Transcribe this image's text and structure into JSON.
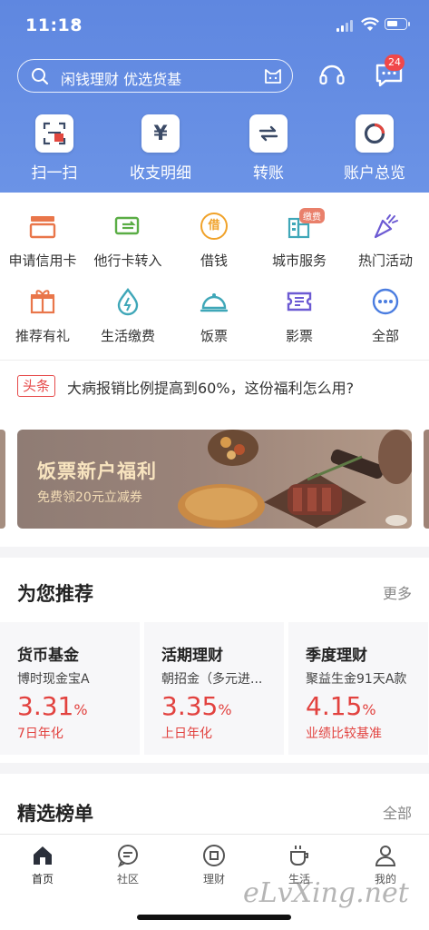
{
  "status_bar": {
    "time": "11:18"
  },
  "search": {
    "placeholder": "闲钱理财 优选货基"
  },
  "header": {
    "message_badge": "24"
  },
  "quick_actions": [
    {
      "label": "扫一扫",
      "icon": "scan-icon"
    },
    {
      "label": "收支明细",
      "icon": "yuan-icon"
    },
    {
      "label": "转账",
      "icon": "transfer-icon"
    },
    {
      "label": "账户总览",
      "icon": "account-overview-icon"
    }
  ],
  "services": [
    {
      "label": "申请信用卡",
      "icon": "credit-card-icon"
    },
    {
      "label": "他行卡转入",
      "icon": "card-transfer-in-icon"
    },
    {
      "label": "借钱",
      "icon": "borrow-icon",
      "icon_text": "借"
    },
    {
      "label": "城市服务",
      "icon": "city-service-icon",
      "badge": "缴费"
    },
    {
      "label": "热门活动",
      "icon": "party-popper-icon"
    },
    {
      "label": "推荐有礼",
      "icon": "gift-icon"
    },
    {
      "label": "生活缴费",
      "icon": "utility-bill-icon"
    },
    {
      "label": "饭票",
      "icon": "dining-cloche-icon"
    },
    {
      "label": "影票",
      "icon": "movie-ticket-icon"
    },
    {
      "label": "全部",
      "icon": "more-dots-icon"
    }
  ],
  "news": {
    "tag": "头条",
    "text": "大病报销比例提高到60%，这份福利怎么用?"
  },
  "banner": {
    "title": "饭票新户福利",
    "subtitle": "免费领20元立减券"
  },
  "recommend": {
    "title": "为您推荐",
    "more": "更多",
    "cards": [
      {
        "name": "货币基金",
        "product": "博时现金宝A",
        "rate": "3.31",
        "unit": "%",
        "desc": "7日年化"
      },
      {
        "name": "活期理财",
        "product": "朝招金（多元进...",
        "rate": "3.35",
        "unit": "%",
        "desc": "上日年化"
      },
      {
        "name": "季度理财",
        "product": "聚益生金91天A款",
        "rate": "4.15",
        "unit": "%",
        "desc": "业绩比较基准"
      }
    ]
  },
  "ranking": {
    "title": "精选榜单",
    "more": "全部"
  },
  "tabs": [
    {
      "label": "首页",
      "icon": "home-icon",
      "active": true
    },
    {
      "label": "社区",
      "icon": "community-chat-icon"
    },
    {
      "label": "理财",
      "icon": "wealth-icon"
    },
    {
      "label": "生活",
      "icon": "coffee-cup-icon"
    },
    {
      "label": "我的",
      "icon": "profile-icon"
    }
  ],
  "watermark": "eLvXing.net",
  "colors": {
    "header_blue": "#5f87e0",
    "accent_red": "#e2423f",
    "badge_red": "#f0484a"
  }
}
